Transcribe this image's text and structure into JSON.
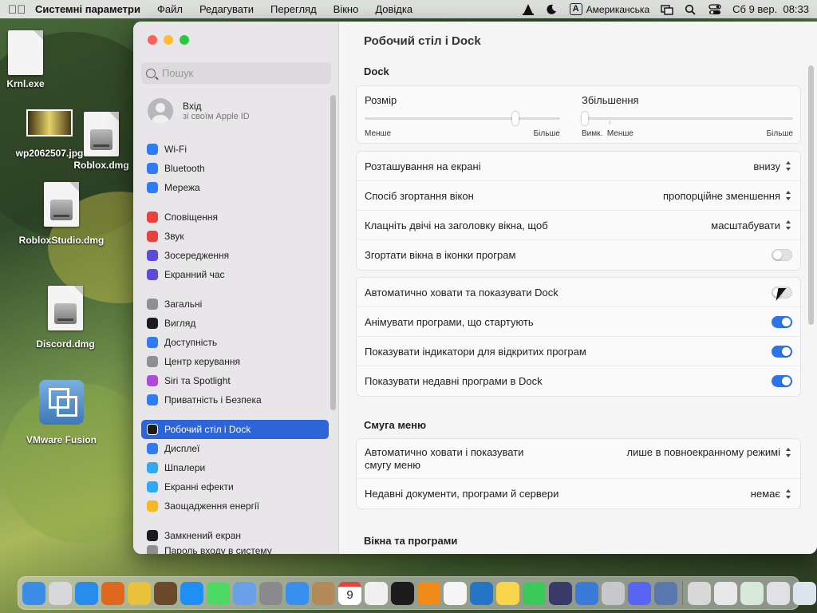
{
  "menubar": {
    "app": "Системні параметри",
    "items": [
      "Файл",
      "Редагувати",
      "Перегляд",
      "Вікно",
      "Довідка"
    ],
    "input_source_badge": "A",
    "input_source": "Американська",
    "clock": "Сб 9 вер.  08:33"
  },
  "desktop": {
    "icons": [
      "Krnl.exe",
      "wp2062507.jpg",
      "Roblox.dmg",
      "RobloxStudio.dmg",
      "Discord.dmg",
      "VMware Fusion"
    ]
  },
  "sidebar": {
    "search_placeholder": "Пошук",
    "apple_id": {
      "title": "Вхід",
      "subtitle": "зі своїм Apple ID"
    },
    "items": [
      {
        "label": "Wi-Fi",
        "color": "#2f7bf6"
      },
      {
        "label": "Bluetooth",
        "color": "#2f7bf6"
      },
      {
        "label": "Мережа",
        "color": "#2f7bf6"
      },
      {
        "label": "Сповіщення",
        "color": "#e9413d"
      },
      {
        "label": "Звук",
        "color": "#e9413d"
      },
      {
        "label": "Зосередження",
        "color": "#5b4bd8"
      },
      {
        "label": "Екранний час",
        "color": "#5b4bd8"
      },
      {
        "label": "Загальні",
        "color": "#8e8e93"
      },
      {
        "label": "Вигляд",
        "color": "#1c1c1e"
      },
      {
        "label": "Доступність",
        "color": "#2f7bf6"
      },
      {
        "label": "Центр керування",
        "color": "#8e8e93"
      },
      {
        "label": "Siri та Spotlight",
        "color": "#b04ad8"
      },
      {
        "label": "Приватність і Безпека",
        "color": "#2f7bf6"
      },
      {
        "label": "Робочий стіл і Dock",
        "color": "#1c1c1e"
      },
      {
        "label": "Дисплеї",
        "color": "#2f7bf6"
      },
      {
        "label": "Шпалери",
        "color": "#2fa8f6"
      },
      {
        "label": "Екранні ефекти",
        "color": "#2fa8f6"
      },
      {
        "label": "Заощадження енергії",
        "color": "#f5b91f"
      },
      {
        "label": "Замкнений екран",
        "color": "#1c1c1e"
      },
      {
        "label": "Пароль входу в систему",
        "color": "#8e8e93"
      }
    ]
  },
  "content": {
    "title": "Робочий стіл і Dock",
    "dock_section": "Dock",
    "size_slider": {
      "label": "Розмір",
      "min_label": "Менше",
      "max_label": "Більше",
      "value": 0.78
    },
    "magnification_slider": {
      "label": "Збільшення",
      "off_label": "Вимк.",
      "min_label": "Менше",
      "max_label": "Більше",
      "value": 0.0
    },
    "rows1": [
      {
        "label": "Розташування на екрані",
        "value": "внизу"
      },
      {
        "label": "Спосіб згортання вікон",
        "value": "пропорційне зменшення"
      },
      {
        "label": "Клацніть двічі на заголовку вікна, щоб",
        "value": "масштабувати"
      },
      {
        "label": "Згортати вікна в іконки програм",
        "toggle": false
      }
    ],
    "rows2": [
      {
        "label": "Автоматично ховати та показувати Dock",
        "toggle": false
      },
      {
        "label": "Анімувати програми, що стартують",
        "toggle": true
      },
      {
        "label": "Показувати індикатори для відкритих програм",
        "toggle": true
      },
      {
        "label": "Показувати недавні програми в Dock",
        "toggle": true
      }
    ],
    "menubar_section": "Смуга меню",
    "menubar_rows": [
      {
        "label_line1": "Автоматично ховати і показувати",
        "label_line2": "смугу меню",
        "value": "лише в повноекранному режимі"
      },
      {
        "label": "Недавні документи, програми й сервери",
        "value": "немає"
      }
    ],
    "windows_section": "Вікна та програми"
  },
  "dock": {
    "apps": [
      {
        "name": "finder",
        "color": "#3d8ce8"
      },
      {
        "name": "launchpad",
        "color": "#d8d8dc"
      },
      {
        "name": "safari",
        "color": "#2a8cea"
      },
      {
        "name": "firefox",
        "color": "#e0671e"
      },
      {
        "name": "chrome",
        "color": "#e8c23a"
      },
      {
        "name": "guitar",
        "color": "#6a4a2a"
      },
      {
        "name": "app-store",
        "color": "#1f8ef5"
      },
      {
        "name": "messages",
        "color": "#4cd964"
      },
      {
        "name": "preview",
        "color": "#6aa0e8"
      },
      {
        "name": "system-settings",
        "color": "#8a8a8e"
      },
      {
        "name": "mail",
        "color": "#3a8ef0"
      },
      {
        "name": "contacts",
        "color": "#b38a58"
      },
      {
        "name": "calendar",
        "color": "#ffffff"
      },
      {
        "name": "textedit",
        "color": "#f0f0f0"
      },
      {
        "name": "terminal",
        "color": "#1c1c1c"
      },
      {
        "name": "vlc",
        "color": "#f08a1a"
      },
      {
        "name": "reminders",
        "color": "#f5f5f5"
      },
      {
        "name": "vscode",
        "color": "#2474c8"
      },
      {
        "name": "notes",
        "color": "#f8d54a"
      },
      {
        "name": "facetime",
        "color": "#3bc95a"
      },
      {
        "name": "quicktime",
        "color": "#3a3a6a"
      },
      {
        "name": "roblox",
        "color": "#3a7ad8"
      },
      {
        "name": "photos-editor",
        "color": "#c8c8cc"
      },
      {
        "name": "discord",
        "color": "#5865f2"
      },
      {
        "name": "roblox-studio",
        "color": "#5a78b0"
      },
      {
        "name": "printer",
        "color": "#d8d8d8"
      },
      {
        "name": "doc-1",
        "color": "#e8e8ea"
      },
      {
        "name": "doc-2",
        "color": "#d8e8d8"
      },
      {
        "name": "doc-3",
        "color": "#e0e0e6"
      },
      {
        "name": "doc-4",
        "color": "#dce4ee"
      },
      {
        "name": "trash",
        "color": "#cfd3d6"
      }
    ],
    "calendar_day": "9"
  }
}
